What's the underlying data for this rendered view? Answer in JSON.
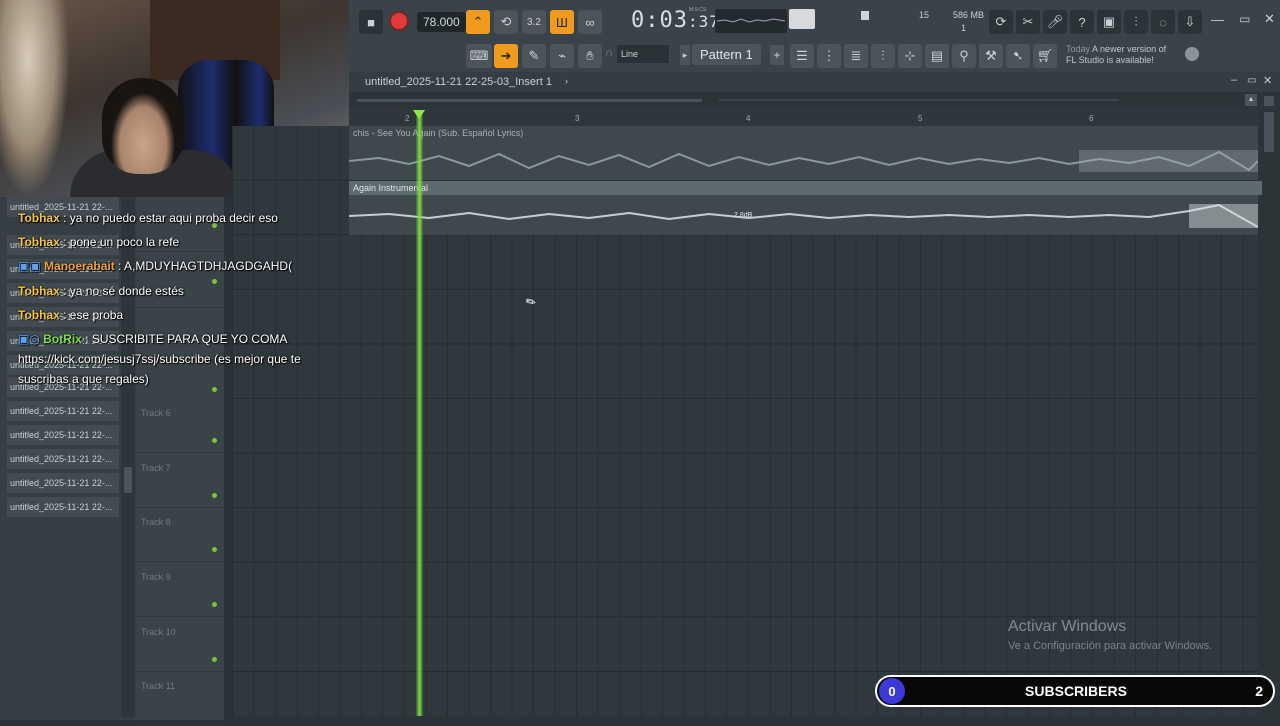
{
  "toolbar": {
    "tempo": "78.000",
    "time_main": "0:03",
    "time_sub": "37",
    "time_unit_label": "M:S:CS",
    "cpu_value": "15",
    "memory": "586 MB",
    "polyphony": "1",
    "snap_mode": "Line",
    "pattern_label": "Pattern 1",
    "news_date": "Today",
    "news_text_1": "A newer version of",
    "news_text_2": "FL Studio is available!"
  },
  "playlist": {
    "title": "untitled_2025-11-21 22-25-03_Insert 1",
    "ruler_marks": [
      "2",
      "3",
      "4",
      "5",
      "6"
    ],
    "clip1_label": "chis - See You Again (Sub. Español  Lyrics)",
    "clip2_label": "Again Instrumental",
    "clip2_db": "2.8dB",
    "tracks": [
      "Track 6",
      "Track 7",
      "Track 8",
      "Track 9",
      "Track 10",
      "Track 11"
    ]
  },
  "left_panel": {
    "items": [
      "untitled_2025-11-21 22-...",
      "untitled_2025-11-21 22-...",
      "untitled_2025-11-21 22-...",
      "untitled_2025-11-21 22-...",
      "untitled_2025-11-21 22-...",
      "untitled_2025-11-21 22-...",
      "untitled_2025-11-21 22-...",
      "untitled_2025-11-21 22-...",
      "untitled_2025-11-21 22-...",
      "untitled_2025-11-21 22-...",
      "untitled_2025-11-21 22-...",
      "untitled_2025-11-21 22-...",
      "untitled_2025-11-21 22-..."
    ]
  },
  "chat": [
    {
      "user": "Tobhax",
      "msg": " : ya no puedo estar aqui proba decir eso",
      "color": "#f5c543"
    },
    {
      "user": "Tobhax",
      "msg": " : pone un poco la refe",
      "color": "#f5c543"
    },
    {
      "user": "Manoerabait",
      "msg": " : A,MDUYHAGTDHJAGDGAHD(",
      "color": "#f0a03a"
    },
    {
      "user": "Tobhax",
      "msg": " : ya no sé donde estés",
      "color": "#f5c543"
    },
    {
      "user": "Tobhax",
      "msg": " : ese proba",
      "color": "#f5c543"
    },
    {
      "user": "BotRix",
      "msg": " : SUSCRIBITE PARA QUE YO COMA",
      "color": "#7be04a"
    },
    {
      "user": "",
      "msg": "https://kick.com/jesusj7ssj/subscribe (es mejor que te",
      "color": "#ffffff"
    },
    {
      "user": "",
      "msg": "suscribas a que regales)",
      "color": "#ffffff"
    }
  ],
  "watermark": {
    "title": "Activar Windows",
    "subtitle": "Ve a Configuración para activar Windows."
  },
  "subs": {
    "current": "0",
    "label": "SUBSCRIBERS",
    "goal": "2"
  }
}
